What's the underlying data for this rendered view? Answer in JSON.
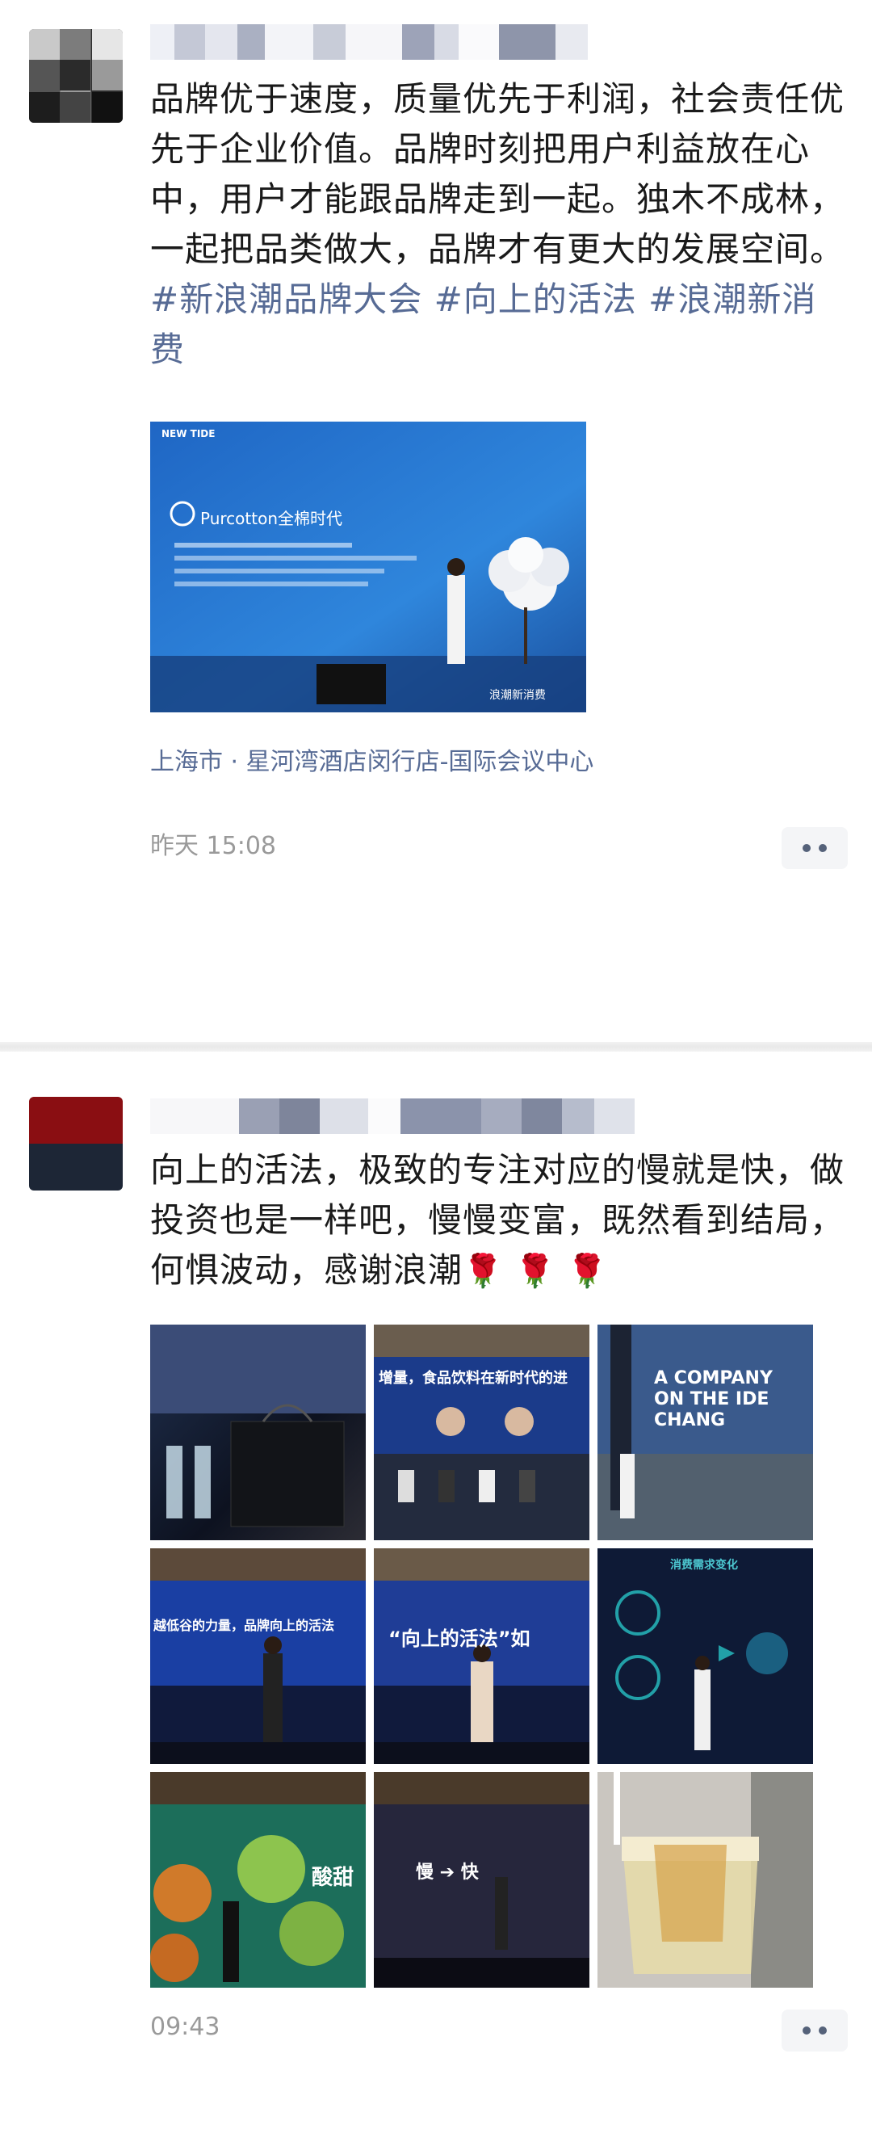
{
  "post1": {
    "text_plain": "品牌优于速度，质量优先于利润，社会责任优先于企业价值。品牌时刻把用户利益放在心中，用户才能跟品牌走到一起。独木不成林，一起把品类做大，品牌才有更大的发展空间。",
    "hashtags": [
      "#新浪潮品牌大会",
      "#向上的活法",
      "#浪潮新消费"
    ],
    "photo": {
      "event_badge": "NEW TIDE",
      "brand": "Purcotton全棉时代",
      "screen_caption": "浪潮新消费"
    },
    "location": "上海市 · 星河湾酒店闵行店-国际会议中心",
    "time": "昨天 15:08"
  },
  "post2": {
    "text_before": "向上的活法，极致的专注对应的慢就是快，做投资也是一样吧，慢慢变富，既然看到结局，何惧波动，感谢浪潮",
    "emoji": "🌹 🌹 🌹",
    "thumbs": [
      {
        "label": ""
      },
      {
        "label": "增量，食品饮料在新时代的进"
      },
      {
        "label": "A COMPANY ON THE IDE CHANG"
      },
      {
        "label": "越低谷的力量，品牌向上的活法"
      },
      {
        "label": "“向上的活法”如"
      },
      {
        "label": "消费需求变化"
      },
      {
        "label": "酸甜"
      },
      {
        "label": "慢 ➔ 快"
      },
      {
        "label": ""
      }
    ],
    "time": "09:43"
  },
  "colors": {
    "link": "#576b95",
    "stage_blue": "#2a6fc0"
  }
}
